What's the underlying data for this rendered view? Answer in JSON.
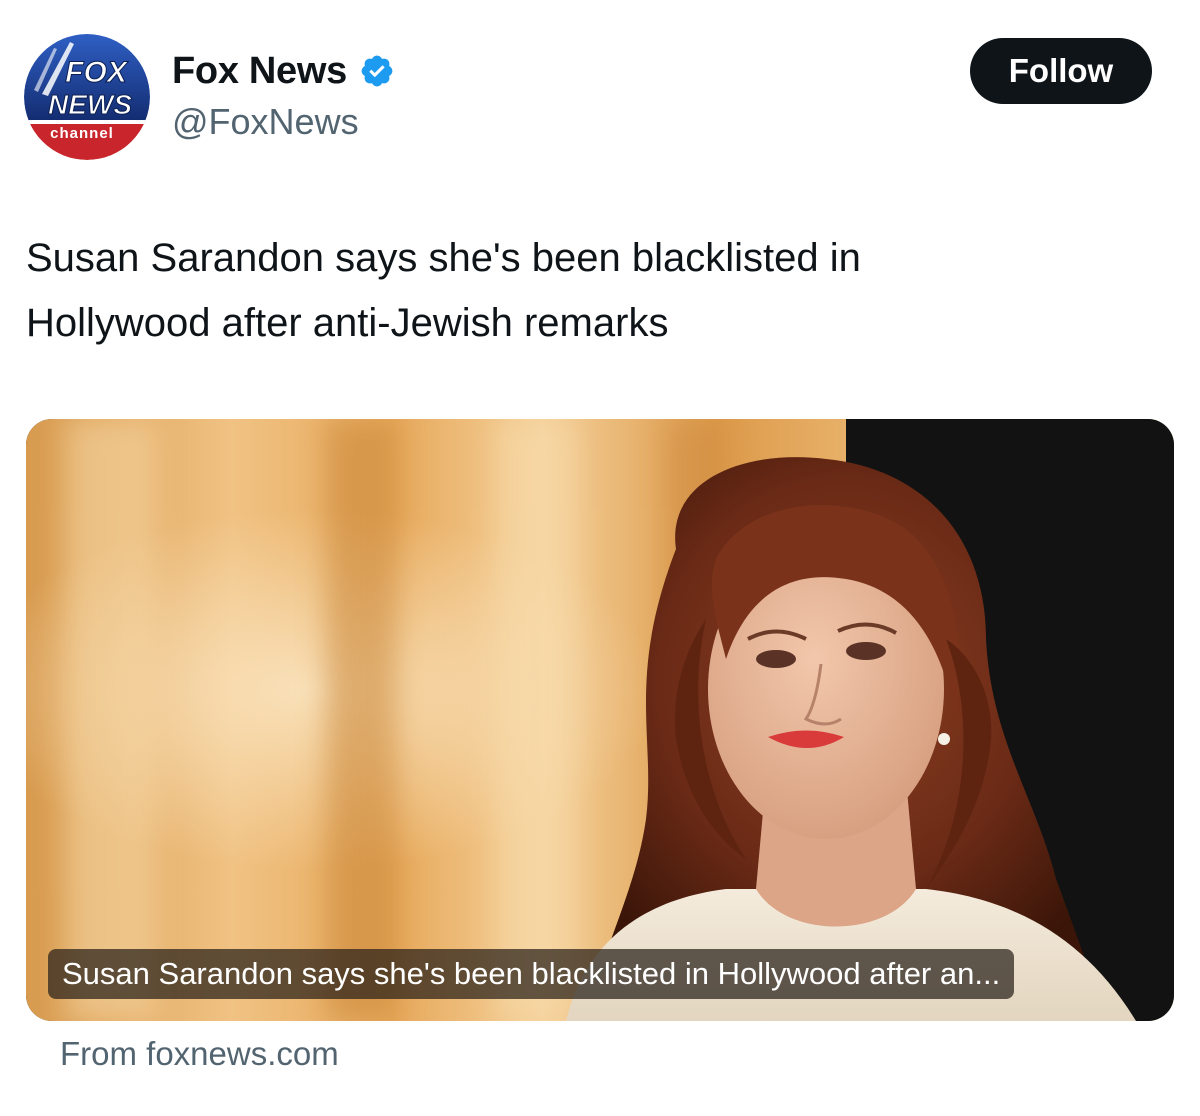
{
  "account": {
    "display_name": "Fox News",
    "handle": "@FoxNews",
    "verified": true,
    "avatar_logo_text": [
      "FOX",
      "NEWS",
      "channel"
    ]
  },
  "follow_label": "Follow",
  "tweet": {
    "lines": [
      "Susan Sarandon says she's been blacklisted in",
      "Hollywood after anti-Jewish remarks"
    ]
  },
  "card": {
    "caption": "Susan Sarandon says she's been blacklisted in Hollywood after an...",
    "source": "From foxnews.com"
  },
  "colors": {
    "text_primary": "#0f1419",
    "text_secondary": "#536471",
    "verified_blue": "#1d9bf0",
    "follow_bg": "#0f1419",
    "logo_blue": "#1f3a8a",
    "logo_red": "#c8262c"
  }
}
